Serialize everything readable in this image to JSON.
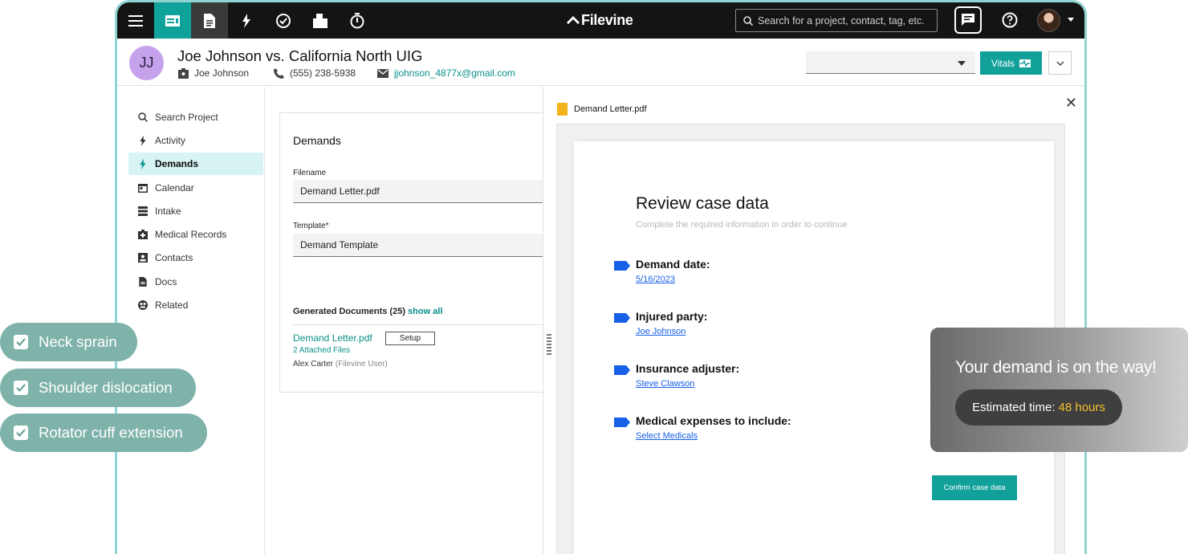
{
  "app": {
    "logo_text": "Filevine",
    "brand_color": "#0fa29b"
  },
  "search": {
    "placeholder": "Search for a project, contact, tag, etc."
  },
  "header": {
    "initials": "JJ",
    "title": "Joe Johnson vs. California North UIG",
    "client": "Joe Johnson",
    "phone": "(555) 238-5938",
    "email": "jjohnson_4877x@gmail.com",
    "vitals_label": "Vitals"
  },
  "sidebar": {
    "items": [
      {
        "label": "Search Project",
        "icon": "search-icon"
      },
      {
        "label": "Activity",
        "icon": "bolt-icon"
      },
      {
        "label": "Demands",
        "icon": "bolt-icon",
        "active": true
      },
      {
        "label": "Calendar",
        "icon": "calendar-icon"
      },
      {
        "label": "Intake",
        "icon": "list-icon"
      },
      {
        "label": "Medical Records",
        "icon": "medical-bag-icon"
      },
      {
        "label": "Contacts",
        "icon": "contact-icon"
      },
      {
        "label": "Docs",
        "icon": "document-icon"
      },
      {
        "label": "Related",
        "icon": "related-icon"
      }
    ]
  },
  "demands": {
    "title": "Demands",
    "filename_label": "Filename",
    "filename_value": "Demand Letter.pdf",
    "template_label": "Template*",
    "template_value": "Demand Template",
    "generated_label": "Generated Documents (25)",
    "show_all": "show all",
    "doc": {
      "name": "Demand Letter.pdf",
      "setup": "Setup",
      "attached": "2 Attached Files",
      "author": "Alex Carter",
      "author_role": "(Filevine User)"
    }
  },
  "viewer": {
    "file_name": "Demand Letter.pdf",
    "title": "Review case data",
    "subtitle": "Complete the required information in order to continue",
    "fields": [
      {
        "label": "Demand date:",
        "value": "5/16/2023"
      },
      {
        "label": "Injured party:",
        "value": "Joe Johnson"
      },
      {
        "label": "Insurance adjuster:",
        "value": "Steve Clawson"
      },
      {
        "label": "Medical expenses to include:",
        "value": "Select Medicals"
      }
    ],
    "confirm_label": "Confirm case data"
  },
  "toast": {
    "message": "Your demand is on the way!",
    "estimate_label": "Estimated time:",
    "estimate_value": "48 hours"
  },
  "chips": [
    {
      "label": "Neck sprain"
    },
    {
      "label": "Shoulder dislocation"
    },
    {
      "label": "Rotator cuff extension"
    }
  ]
}
